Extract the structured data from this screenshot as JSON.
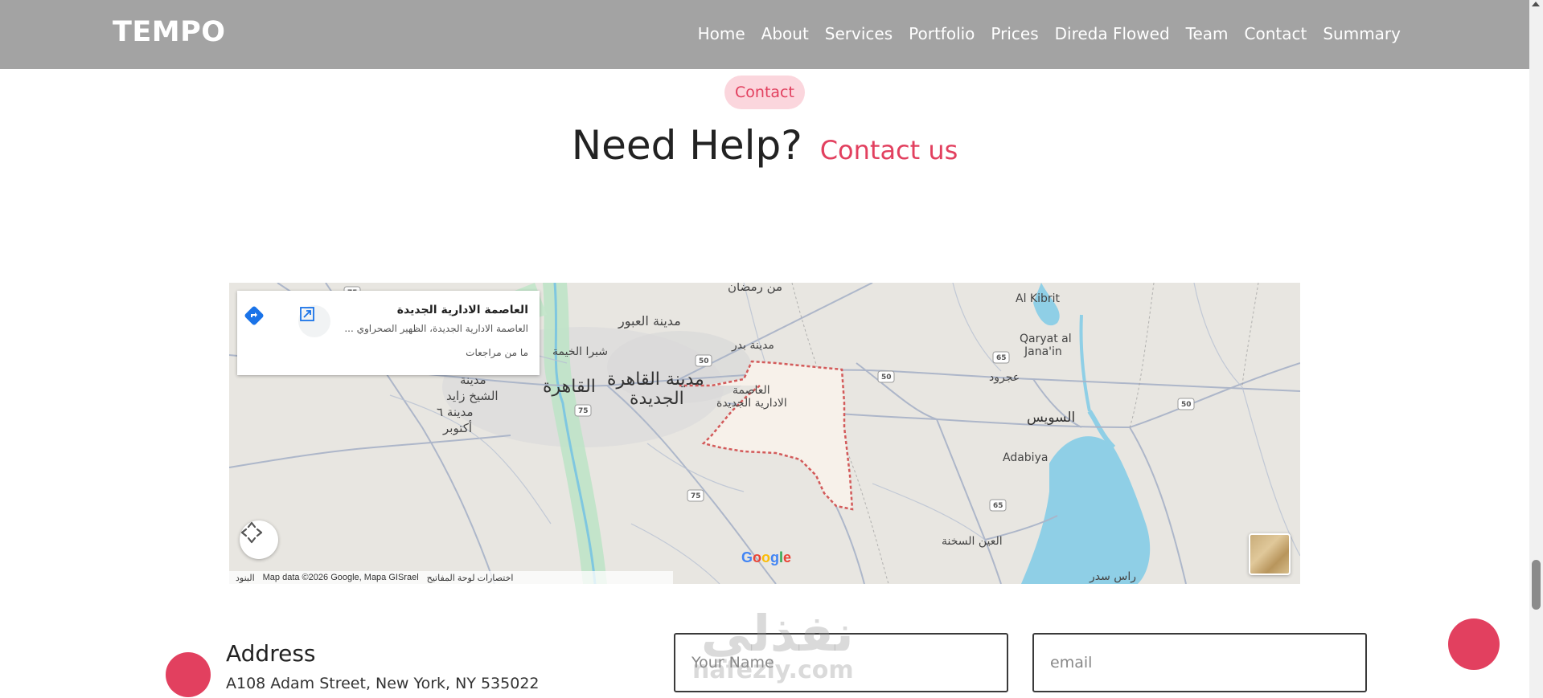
{
  "header": {
    "brand": "TEMPO",
    "nav": [
      "Home",
      "About",
      "Services",
      "Portfolio",
      "Prices",
      "Direda Flowed",
      "Team",
      "Contact",
      "Summary"
    ]
  },
  "contact_section": {
    "badge": "Contact",
    "title": "Need Help?",
    "title_accent": "Contact us"
  },
  "map": {
    "place_title": "العاصمة الادارية الجديدة",
    "place_address": "العاصمة الادارية الجديدة، الظهير الصحراوي ...",
    "reviews": "ما من مراجعات",
    "labels": {
      "ramadan": "من رمضان",
      "obour": "مدينة العبور",
      "badr": "مدينة بدر",
      "shubra": "شبرا الخيمة",
      "cairo": "مدينة القاهرة",
      "new_cairo": "الجديدة",
      "cairo2": "القاهرة",
      "capital1": "العاصمة",
      "capital2": "الادارية الجديدة",
      "madina": "مدينة",
      "zayed": "الشيخ زايد",
      "sixth": "مدينة ٦",
      "october": "أكتوبر",
      "al_kibrit": "Al Kibrit",
      "qaryat1": "Qaryat al",
      "qaryat2": "Jana'in",
      "agroud": "عجرود",
      "suez": "السويس",
      "adabiya": "Adabiya",
      "sokhna": "العين السخنة",
      "ras_sudr": "راس سدر"
    },
    "road_shields": [
      "75",
      "50",
      "65",
      "50",
      "50",
      "75",
      "75",
      "65"
    ],
    "google_logo": "Google",
    "attribution": {
      "terms": "البنود",
      "data": "Map data ©2026 Google, Mapa GISrael",
      "shortcuts": "اختصارات لوحة المفاتيح"
    }
  },
  "address": {
    "heading": "Address",
    "text": "A108 Adam Street, New York, NY 535022"
  },
  "form": {
    "name_placeholder": "Your Name",
    "email_placeholder": "email"
  },
  "watermark": {
    "arabic": "نفذلي",
    "latin": "nafezly.com"
  },
  "colors": {
    "accent": "#e2405f",
    "badge_bg": "#fbd6dd",
    "navbar_bg": "#a3a3a3",
    "map_bg": "#e8e6e1",
    "water": "#8fcfe6",
    "boundary": "#d35a5a"
  },
  "icons": [
    "directions-icon",
    "expand-icon",
    "pan-arrows-icon",
    "google-logo",
    "satellite-thumbnail"
  ]
}
